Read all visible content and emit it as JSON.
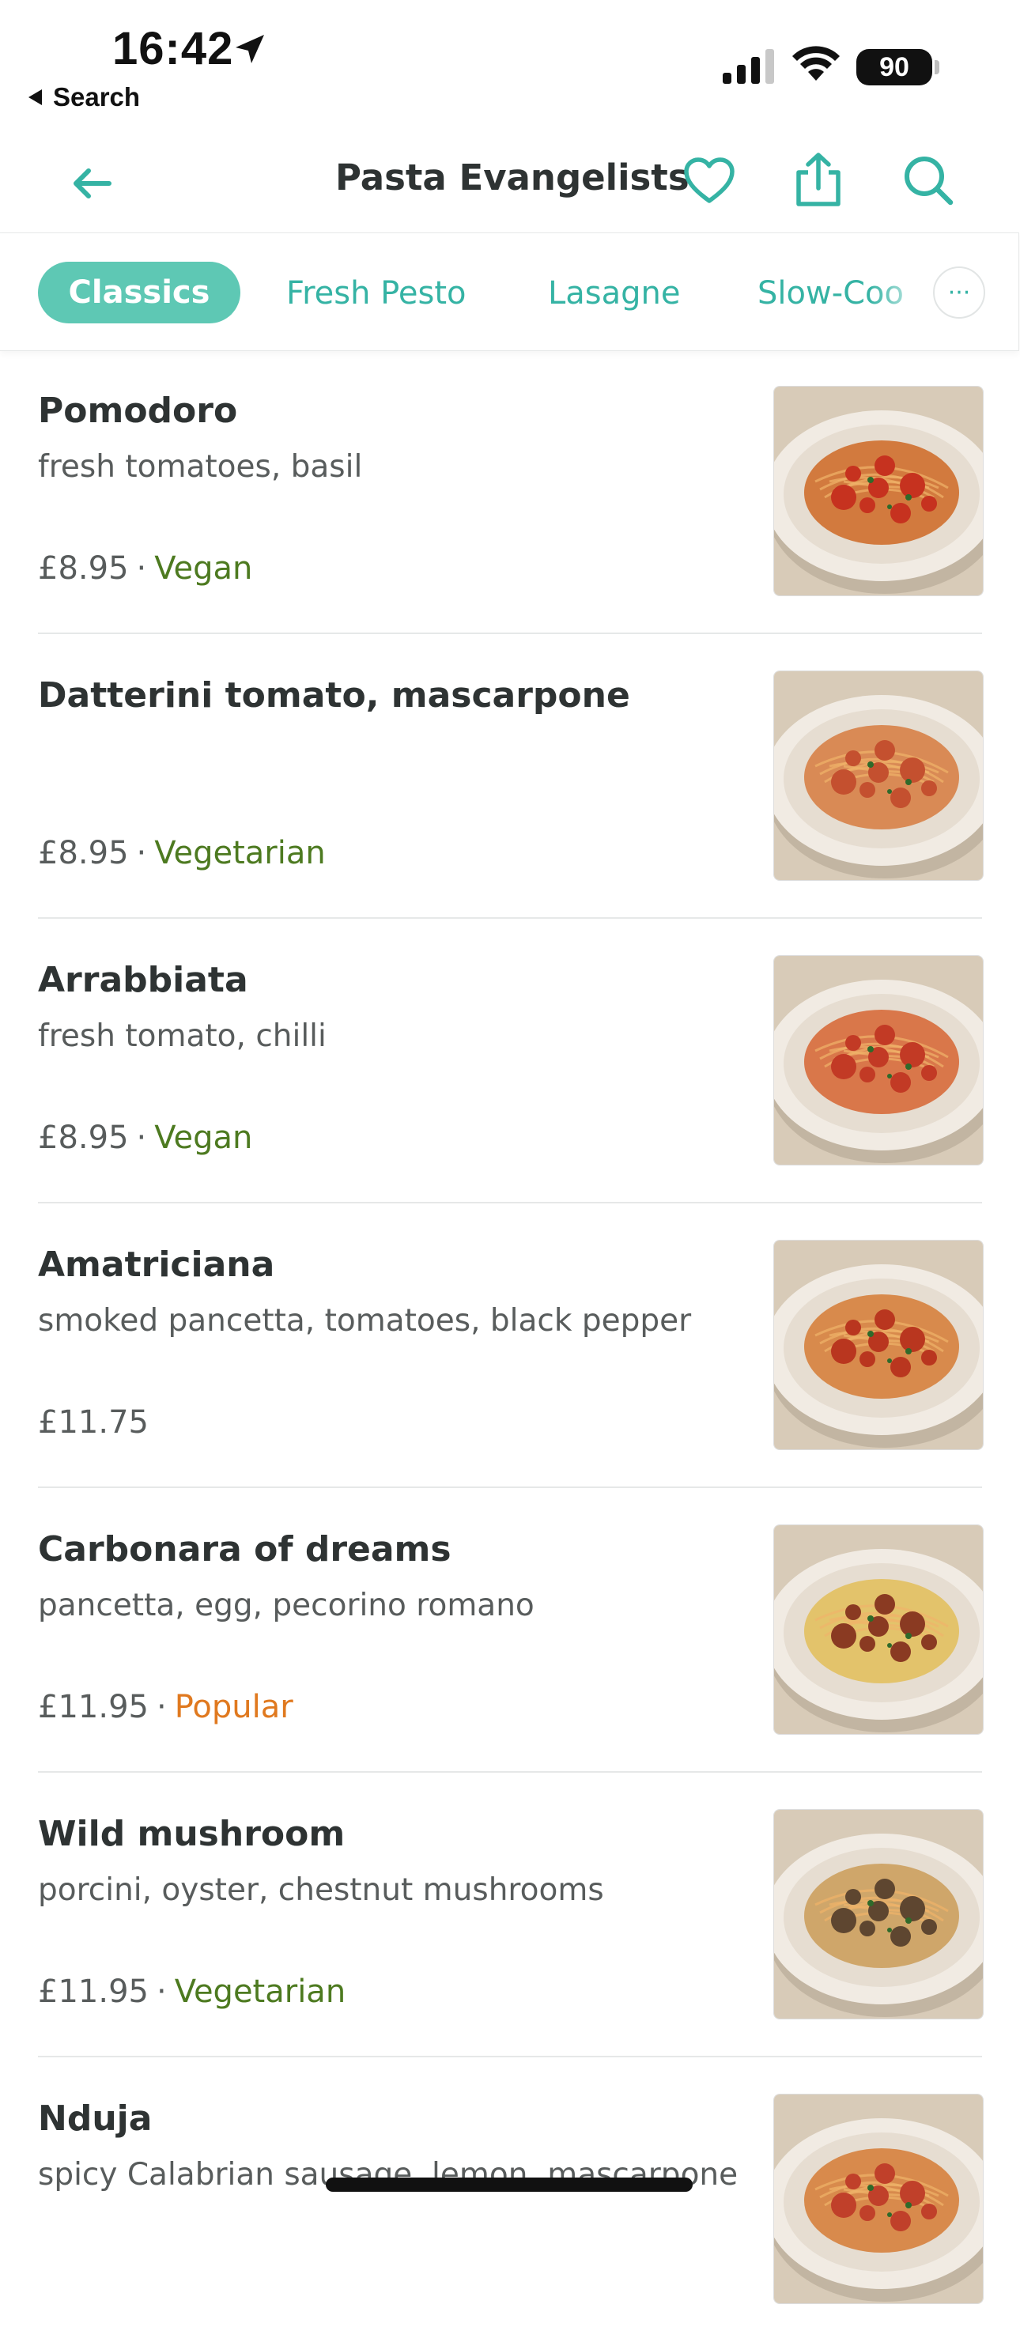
{
  "status_bar": {
    "time": "16:42",
    "back_app_label": "Search",
    "battery_percent": "90"
  },
  "header": {
    "title": "Pasta Evangelists"
  },
  "categories": {
    "items": [
      "Classics",
      "Fresh Pesto",
      "Lasagne",
      "Slow-Coo"
    ],
    "selected": "Classics",
    "more_glyph": "···"
  },
  "colors": {
    "accent": "#5ec8b4",
    "accent_text": "#35b3a4",
    "tag_green": "#4d7a20",
    "tag_orange": "#e0791f",
    "text_primary": "#2e3333",
    "text_secondary": "#585c5c"
  },
  "menu": {
    "items": [
      {
        "name": "Pomodoro",
        "description": "fresh tomatoes, basil",
        "price": "£8.95",
        "tag": "Vegan",
        "tag_color": "green",
        "sauce": "#c6321f",
        "pasta": "#d27a3e"
      },
      {
        "name": "Datterini tomato, mascarpone",
        "description": "",
        "price": "£8.95",
        "tag": "Vegetarian",
        "tag_color": "green",
        "sauce": "#c4502f",
        "pasta": "#d98a55"
      },
      {
        "name": "Arrabbiata",
        "description": "fresh tomato, chilli",
        "price": "£8.95",
        "tag": "Vegan",
        "tag_color": "green",
        "sauce": "#c23a25",
        "pasta": "#d9774a"
      },
      {
        "name": "Amatriciana",
        "description": "smoked pancetta, tomatoes, black pepper",
        "price": "£11.75",
        "tag": "",
        "tag_color": "",
        "sauce": "#b9361f",
        "pasta": "#d88a4c"
      },
      {
        "name": "Carbonara of dreams",
        "description": "pancetta, egg, pecorino romano",
        "price": "£11.95",
        "tag": "Popular",
        "tag_color": "orange",
        "sauce": "#8a3a22",
        "pasta": "#e3c36b"
      },
      {
        "name": "Wild mushroom",
        "description": "porcini, oyster, chestnut mushrooms",
        "price": "£11.95",
        "tag": "Vegetarian",
        "tag_color": "green",
        "sauce": "#5e4630",
        "pasta": "#cfa66a"
      },
      {
        "name": "Nduja",
        "description": "spicy Calabrian sausage, lemon, mascarpone",
        "price": "",
        "tag": "",
        "tag_color": "",
        "sauce": "#c0402a",
        "pasta": "#d88a4c"
      }
    ]
  }
}
